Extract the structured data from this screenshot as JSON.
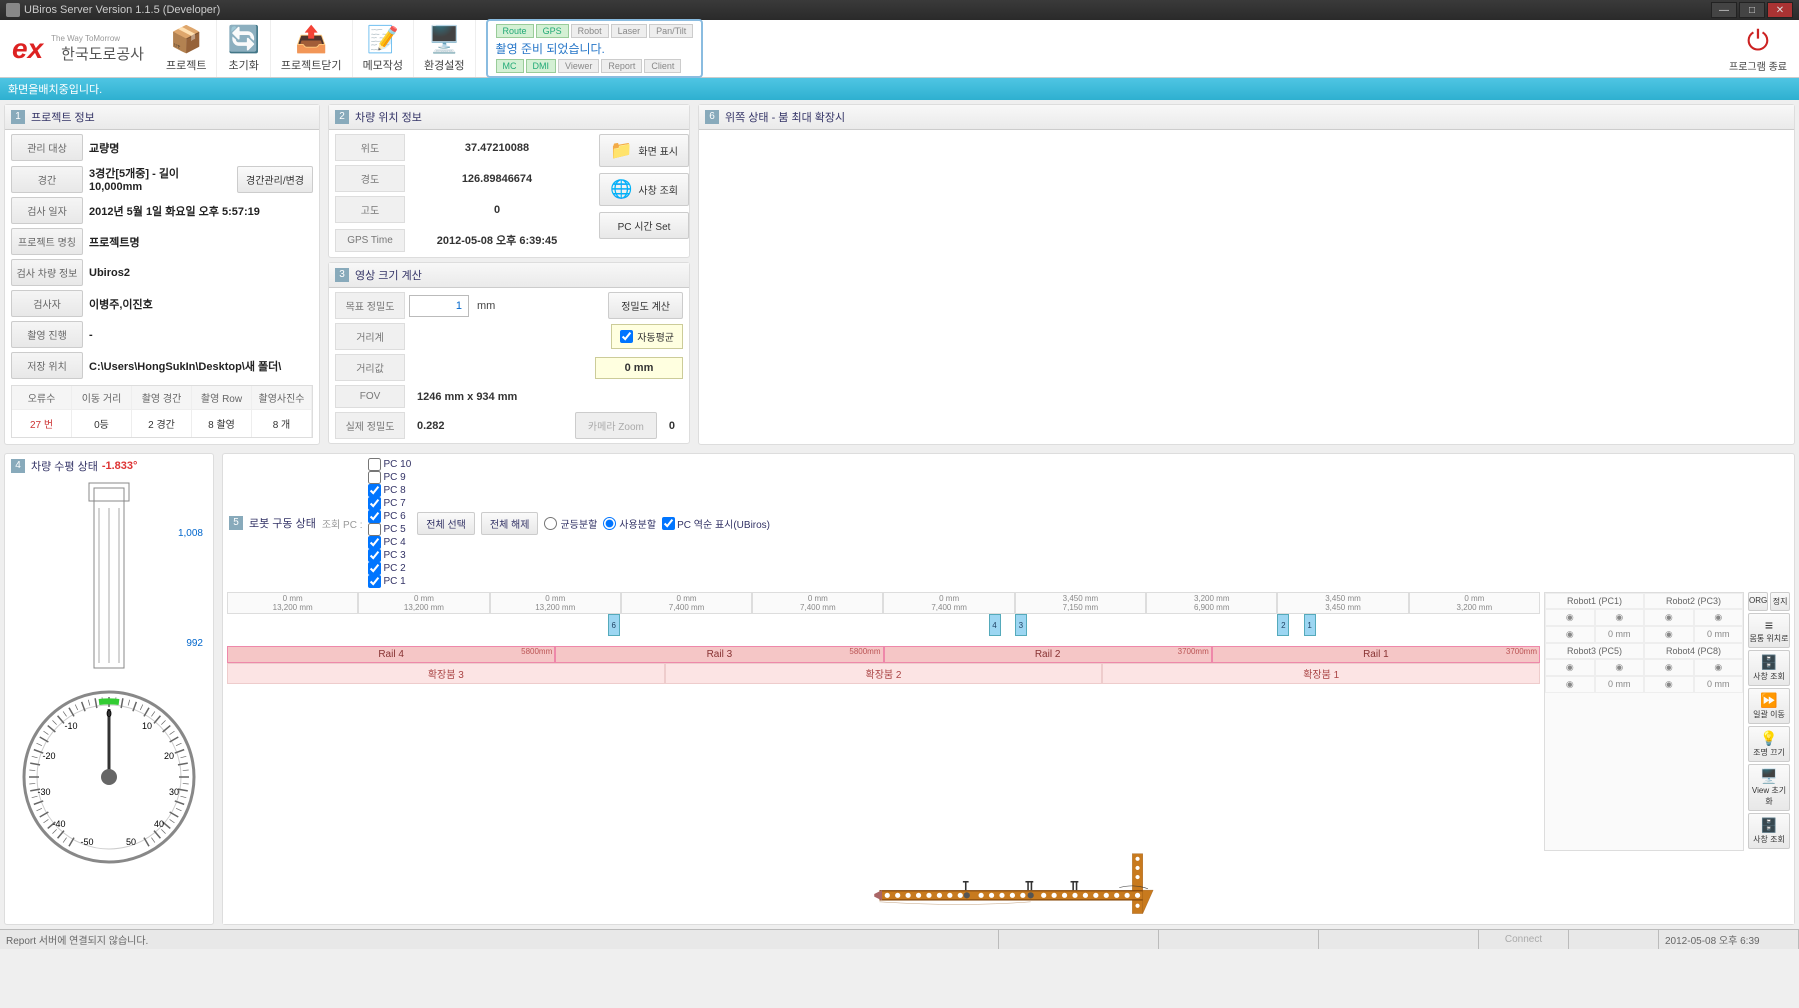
{
  "window": {
    "title": "UBiros Server Version 1.1.5 (Developer)"
  },
  "ribbon": {
    "logo_tag": "The Way ToMorrow",
    "logo_txt": "한국도로공사",
    "buttons": {
      "project": "프로젝트",
      "reset": "초기화",
      "close_project": "프로젝트닫기",
      "memo": "메모작성",
      "env": "환경설정"
    },
    "status_tabs_top": [
      "Route",
      "GPS",
      "Robot",
      "Laser",
      "Pan/Tilt"
    ],
    "status_msg": "촬영 준비 되었습니다.",
    "status_tabs_bot": [
      "MC",
      "DMI",
      "Viewer",
      "Report",
      "Client"
    ],
    "exit": "프로그램 종료"
  },
  "substatus": "화면을배치중입니다.",
  "sections": {
    "s1": "프로젝트 정보",
    "s2": "차량 위치 정보",
    "s3": "영상 크기 계산",
    "s4": "차량 수평 상태",
    "s5": "로봇 구동 상태",
    "s6": "위쪽 상태 - 붐 최대 확장시"
  },
  "project": {
    "rows": [
      {
        "lbl": "관리 대상",
        "val": "교량명"
      },
      {
        "lbl": "경간",
        "val": "3경간[5개중] - 길이 10,000mm",
        "btn": "경간관리/변경"
      },
      {
        "lbl": "검사 일자",
        "val": "2012년 5월 1일 화요일 오후 5:57:19"
      },
      {
        "lbl": "프로젝트 명칭",
        "val": "프로젝트명"
      },
      {
        "lbl": "검사 차량 정보",
        "val": "Ubiros2"
      },
      {
        "lbl": "검사자",
        "val": "이병주,이진호"
      },
      {
        "lbl": "촬영 진행",
        "val": "-"
      },
      {
        "lbl": "저장 위치",
        "val": "C:\\Users\\HongSukIn\\Desktop\\새 폴더\\"
      }
    ],
    "stats": {
      "hdr": [
        "오류수",
        "이동 거리",
        "촬영 경간",
        "촬영 Row",
        "촬영사진수"
      ],
      "val": [
        "27 번",
        "0등",
        "2 경간",
        "8 촬영",
        "8 개"
      ]
    }
  },
  "gps": {
    "rows": [
      {
        "lbl": "위도",
        "val": "37.47210088"
      },
      {
        "lbl": "경도",
        "val": "126.89846674"
      },
      {
        "lbl": "고도",
        "val": "0"
      },
      {
        "lbl": "GPS Time",
        "val": "2012-05-08 오후 6:39:45"
      }
    ],
    "btn_screen": "화면 표시",
    "btn_photo": "사창 조회",
    "btn_pcset": "PC 시간 Set"
  },
  "imgcalc": {
    "target_lbl": "목표 정밀도",
    "target_val": "1",
    "unit": "mm",
    "btn_calc": "정밀도 계산",
    "dist_lbl": "거리계",
    "auto_lbl": "자동평균",
    "distval_lbl": "거리값",
    "mm_val": "0 mm",
    "fov_lbl": "FOV",
    "fov_val": "1246 mm x 934 mm",
    "actual_lbl": "실제 정밀도",
    "actual_val": "0.282",
    "zoom_btn": "카메라 Zoom",
    "zoom_val": "0"
  },
  "level": {
    "value": "-1.833°",
    "mark_hi": "1,008",
    "mark_lo": "992"
  },
  "robot_toolbar": {
    "lbl": "조회 PC :",
    "pcs": [
      "PC 10",
      "PC 9",
      "PC 8",
      "PC 7",
      "PC 6",
      "PC 5",
      "PC 4",
      "PC 3",
      "PC 2",
      "PC 1"
    ],
    "checked": [
      false,
      false,
      true,
      true,
      true,
      false,
      true,
      true,
      true,
      true
    ],
    "btn_all": "전체 선택",
    "btn_none": "전체 해제",
    "split_even": "균등분할",
    "split_use": "사용분할",
    "pc_reverse": "PC 역순 표시(UBiros)"
  },
  "rails": {
    "hdrs": [
      {
        "t": "0 mm",
        "b": "13,200 mm"
      },
      {
        "t": "0 mm",
        "b": "13,200 mm"
      },
      {
        "t": "0 mm",
        "b": "13,200 mm"
      },
      {
        "t": "0 mm",
        "b": "7,400 mm"
      },
      {
        "t": "0 mm",
        "b": "7,400 mm"
      },
      {
        "t": "0 mm",
        "b": "7,400 mm"
      },
      {
        "t": "3,450 mm",
        "b": "7,150 mm"
      },
      {
        "t": "3,200 mm",
        "b": "6,900 mm"
      },
      {
        "t": "3,450 mm",
        "b": "3,450 mm"
      },
      {
        "t": "0 mm",
        "b": "3,200 mm"
      }
    ],
    "segs": [
      {
        "name": "Rail 4",
        "len": "5800mm"
      },
      {
        "name": "Rail 3",
        "len": "5800mm"
      },
      {
        "name": "Rail 2",
        "len": "3700mm"
      },
      {
        "name": "Rail 1",
        "len": "3700mm"
      }
    ],
    "exts": [
      "확장붐 3",
      "확장붐 2",
      "확장붐 1"
    ],
    "markers": [
      "6",
      "4",
      "3",
      "2",
      "1"
    ]
  },
  "robot_panel": {
    "hdr": [
      "Robot1 (PC1)",
      "Robot2 (PC3)",
      "Robot3 (PC5)",
      "Robot4 (PC8)"
    ],
    "mm": "0 mm"
  },
  "side_tools": {
    "org": "ORG",
    "stop": "정지",
    "home": "몸통 위치로",
    "photo": "사창 조회",
    "move": "일괄 이동",
    "light": "조명 끄기",
    "view": "View 초기화",
    "photo2": "사창 조회"
  },
  "statusbar": {
    "msg": "Report 서버에 연결되지 않습니다.",
    "connect": "Connect",
    "datetime": "2012-05-08 오후 6:39"
  }
}
